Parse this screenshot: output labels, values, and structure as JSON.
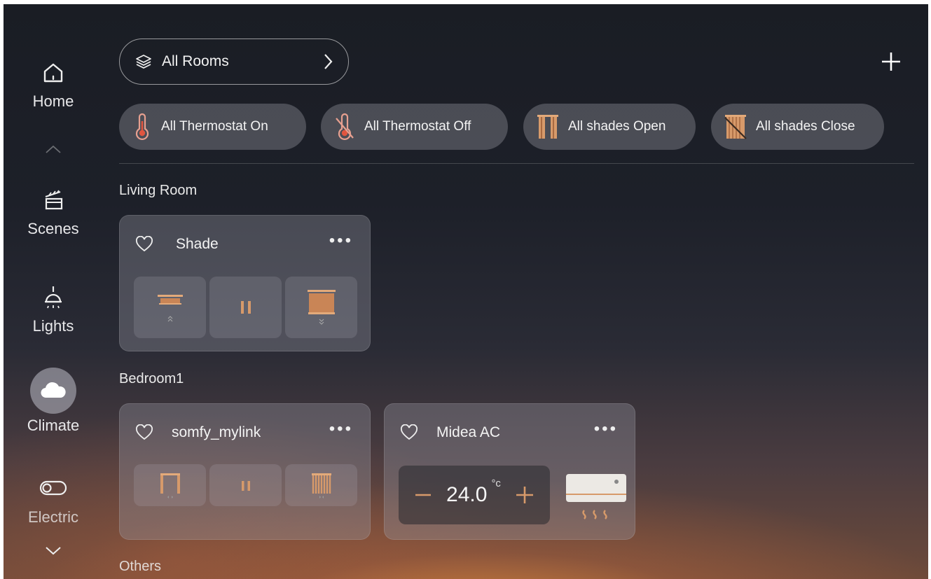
{
  "sidebar": {
    "items": [
      {
        "label": "Home",
        "icon": "home-icon"
      },
      {
        "label": "Scenes",
        "icon": "clapperboard-icon"
      },
      {
        "label": "Lights",
        "icon": "ceiling-light-icon"
      },
      {
        "label": "Climate",
        "icon": "cloud-icon",
        "active": true
      },
      {
        "label": "Electric",
        "icon": "toggle-switch-icon"
      }
    ]
  },
  "header": {
    "room_selector": {
      "label": "All Rooms",
      "icon": "layers-icon"
    },
    "add_icon": "plus-icon"
  },
  "quick_actions": [
    {
      "label": "All Thermostat On",
      "icon": "thermometer-icon"
    },
    {
      "label": "All Thermostat Off",
      "icon": "thermometer-off-icon"
    },
    {
      "label": "All shades Open",
      "icon": "shades-open-icon"
    },
    {
      "label": "All shades Close",
      "icon": "shades-close-icon"
    }
  ],
  "sections": [
    {
      "title": "Living Room",
      "devices": [
        {
          "name": "Shade",
          "type": "shade",
          "controls": [
            "open",
            "pause",
            "close"
          ]
        }
      ]
    },
    {
      "title": "Bedroom1",
      "devices": [
        {
          "name": "somfy_mylink",
          "type": "curtain",
          "controls": [
            "open",
            "pause",
            "close"
          ]
        },
        {
          "name": "Midea AC",
          "type": "ac",
          "temperature": "24.0",
          "unit": "°c"
        }
      ]
    },
    {
      "title": "Others",
      "devices": []
    }
  ],
  "colors": {
    "accent": "#d79a6a",
    "accent_dark": "#a86a42"
  }
}
